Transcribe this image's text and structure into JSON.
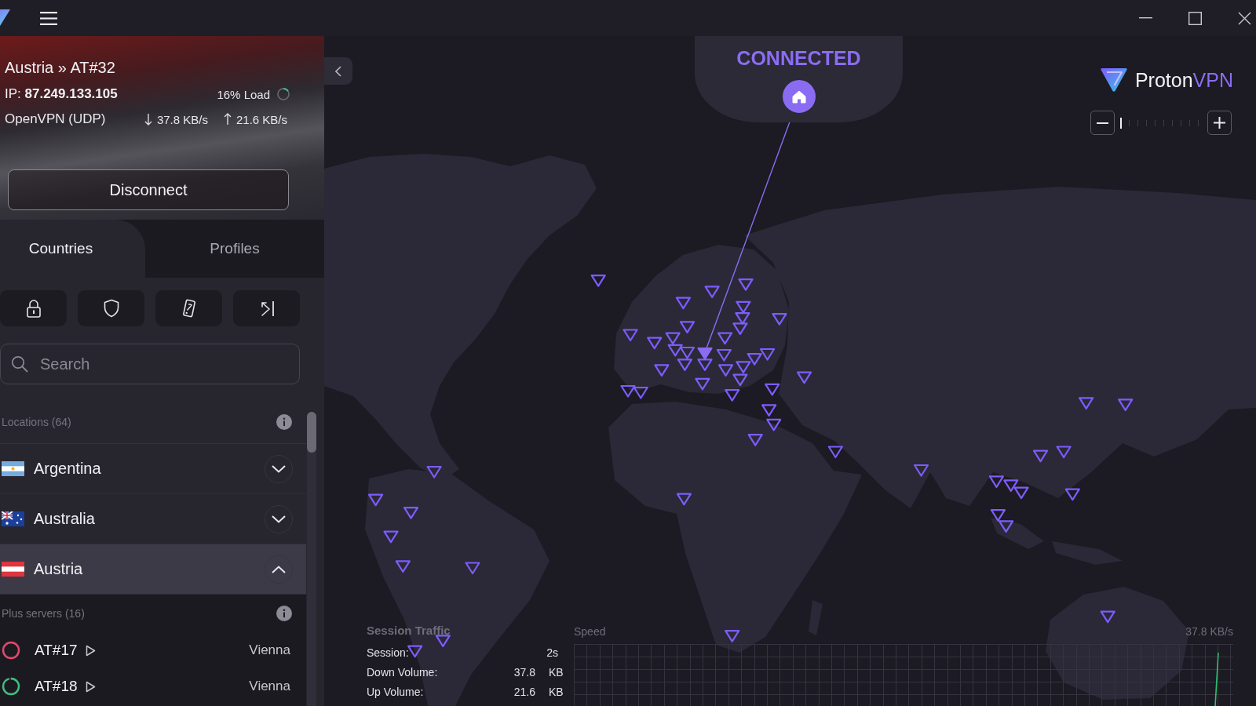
{
  "connection": {
    "server": "Austria » AT#32",
    "ip": "IP: **87.249.133.105**",
    "load": {
      "text": "16% Load",
      "level": 0.16
    },
    "protocol": "OpenVPN (UDP)",
    "download": "37.8 KB/s",
    "upload": "21.6 KB/s"
  },
  "disconnect_button": "Disconnect",
  "tabs": [
    {
      "label": "Countries",
      "selected": true
    },
    {
      "label": "Profiles",
      "selected": false
    }
  ],
  "search": {
    "placeholder": "Search"
  },
  "locations": {
    "heading": "Locations (64)",
    "countries": [
      {
        "name": "Argentina",
        "kind": "ar",
        "selected": false,
        "expanded": false
      },
      {
        "name": "Australia",
        "kind": "au",
        "selected": false,
        "expanded": false
      },
      {
        "name": "Austria",
        "kind": "at",
        "selected": true,
        "expanded": true,
        "servers": {
          "heading": "Plus servers (16)",
          "items": [
            {
              "name": "AT#17",
              "city": "Vienna",
              "level": 1,
              "color": "#e0476b"
            },
            {
              "name": "AT#18",
              "city": "Vienna",
              "level": 0.95,
              "color": "#3fbf7f"
            }
          ]
        }
      }
    ]
  },
  "map": {
    "status": "CONNECTED",
    "brand": {
      "name": "Proton",
      "product": "VPN"
    },
    "zoom": {
      "level": 0
    }
  },
  "session_traffic": {
    "title": "Session Traffic",
    "rows": [
      {
        "label": "Session:",
        "value": "2s"
      },
      {
        "label": "Down Volume:",
        "value": "37.8",
        "unit": "KB"
      },
      {
        "label": "Up Volume:",
        "value": "21.6",
        "unit": "KB"
      }
    ]
  },
  "speed": {
    "title": "Speed",
    "max": "37.8 KB/s"
  }
}
